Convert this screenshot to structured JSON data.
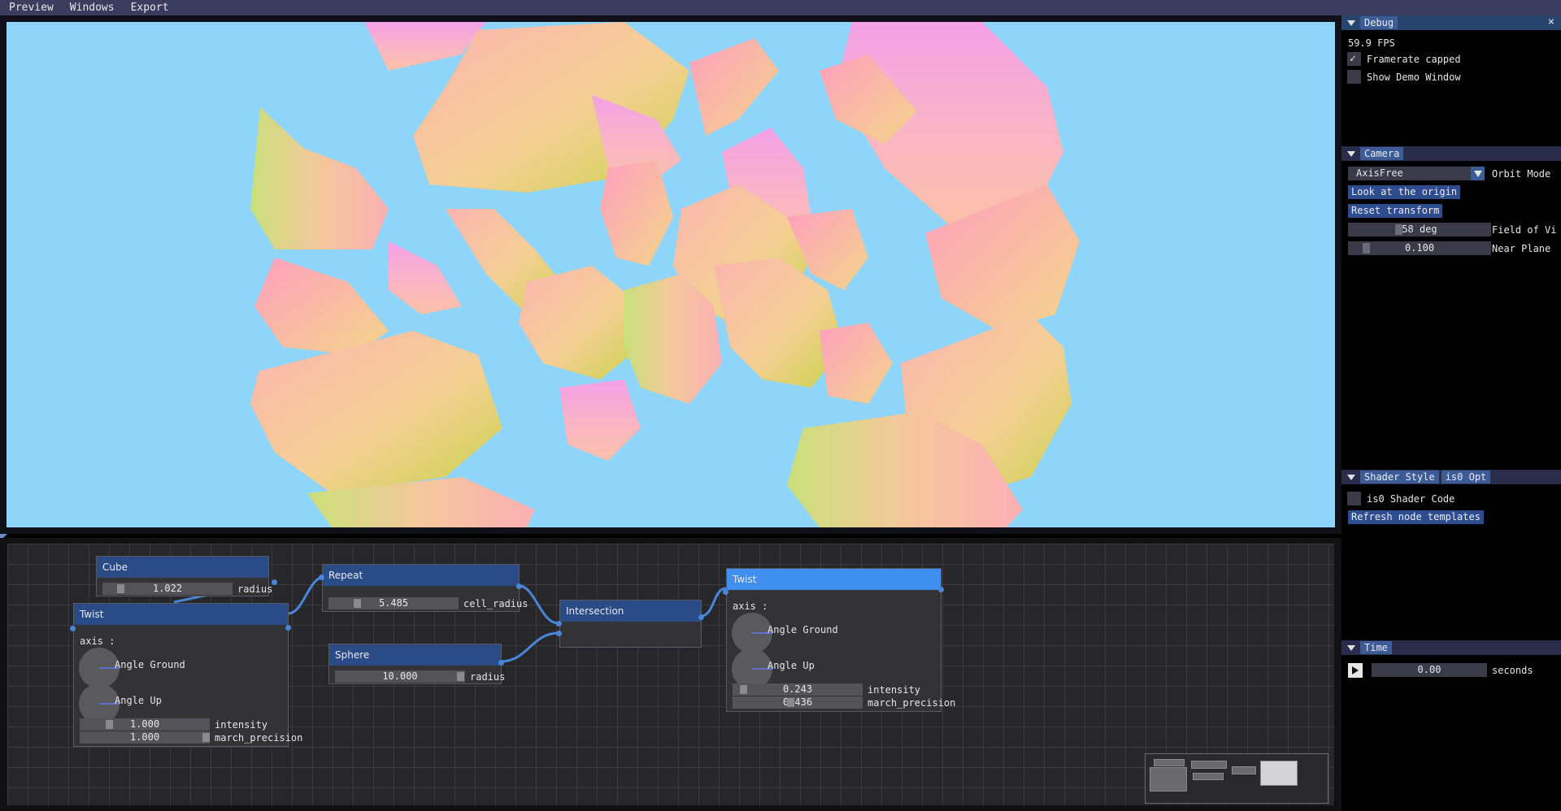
{
  "menu": [
    "Preview",
    "Windows",
    "Export"
  ],
  "nodes": {
    "cube": {
      "title": "Cube",
      "radius_value": "1.022",
      "radius_label": "radius",
      "fraction": 0.12
    },
    "twist_left": {
      "title": "Twist",
      "axis_label": "axis :",
      "knob1": "Angle Ground",
      "knob2": "Angle Up",
      "intensity_value": "1.000",
      "intensity_label": "intensity",
      "intensity_fraction": 0.22,
      "march_value": "1.000",
      "march_label": "march_precision",
      "march_fraction": 0.98
    },
    "repeat": {
      "title": "Repeat",
      "value": "5.485",
      "label": "cell_radius",
      "fraction": 0.2
    },
    "sphere": {
      "title": "Sphere",
      "value": "10.000",
      "label": "radius",
      "fraction": 0.97
    },
    "intersection": {
      "title": "Intersection"
    },
    "twist_right": {
      "title": "Twist",
      "axis_label": "axis :",
      "knob1": "Angle Ground",
      "knob2": "Angle Up",
      "intensity_value": "0.243",
      "intensity_label": "intensity",
      "intensity_fraction": 0.06,
      "march_value": "0.436",
      "march_label": "march_precision",
      "march_fraction": 0.43
    }
  },
  "debug": {
    "title": "Debug",
    "close": "×",
    "fps": "59.9 FPS",
    "framerate_capped": "Framerate capped",
    "show_demo": "Show Demo Window",
    "checkmark": "✓"
  },
  "camera": {
    "title": "Camera",
    "mode_value": "AxisFree",
    "mode_label": "Orbit Mode",
    "look_btn": "Look at the origin",
    "reset_btn": "Reset transform",
    "fov_value": "58 deg",
    "fov_label": "Field of Vi",
    "fov_fraction": 0.33,
    "near_value": "0.100",
    "near_label": "Near Plane",
    "near_fraction": 0.1
  },
  "shader": {
    "title": "Shader Style",
    "tab2": "is0 Opt",
    "checkbox_label": "is0 Shader Code",
    "refresh_btn": "Refresh node templates"
  },
  "time": {
    "title": "Time",
    "value": "0.00",
    "unit": "seconds"
  }
}
